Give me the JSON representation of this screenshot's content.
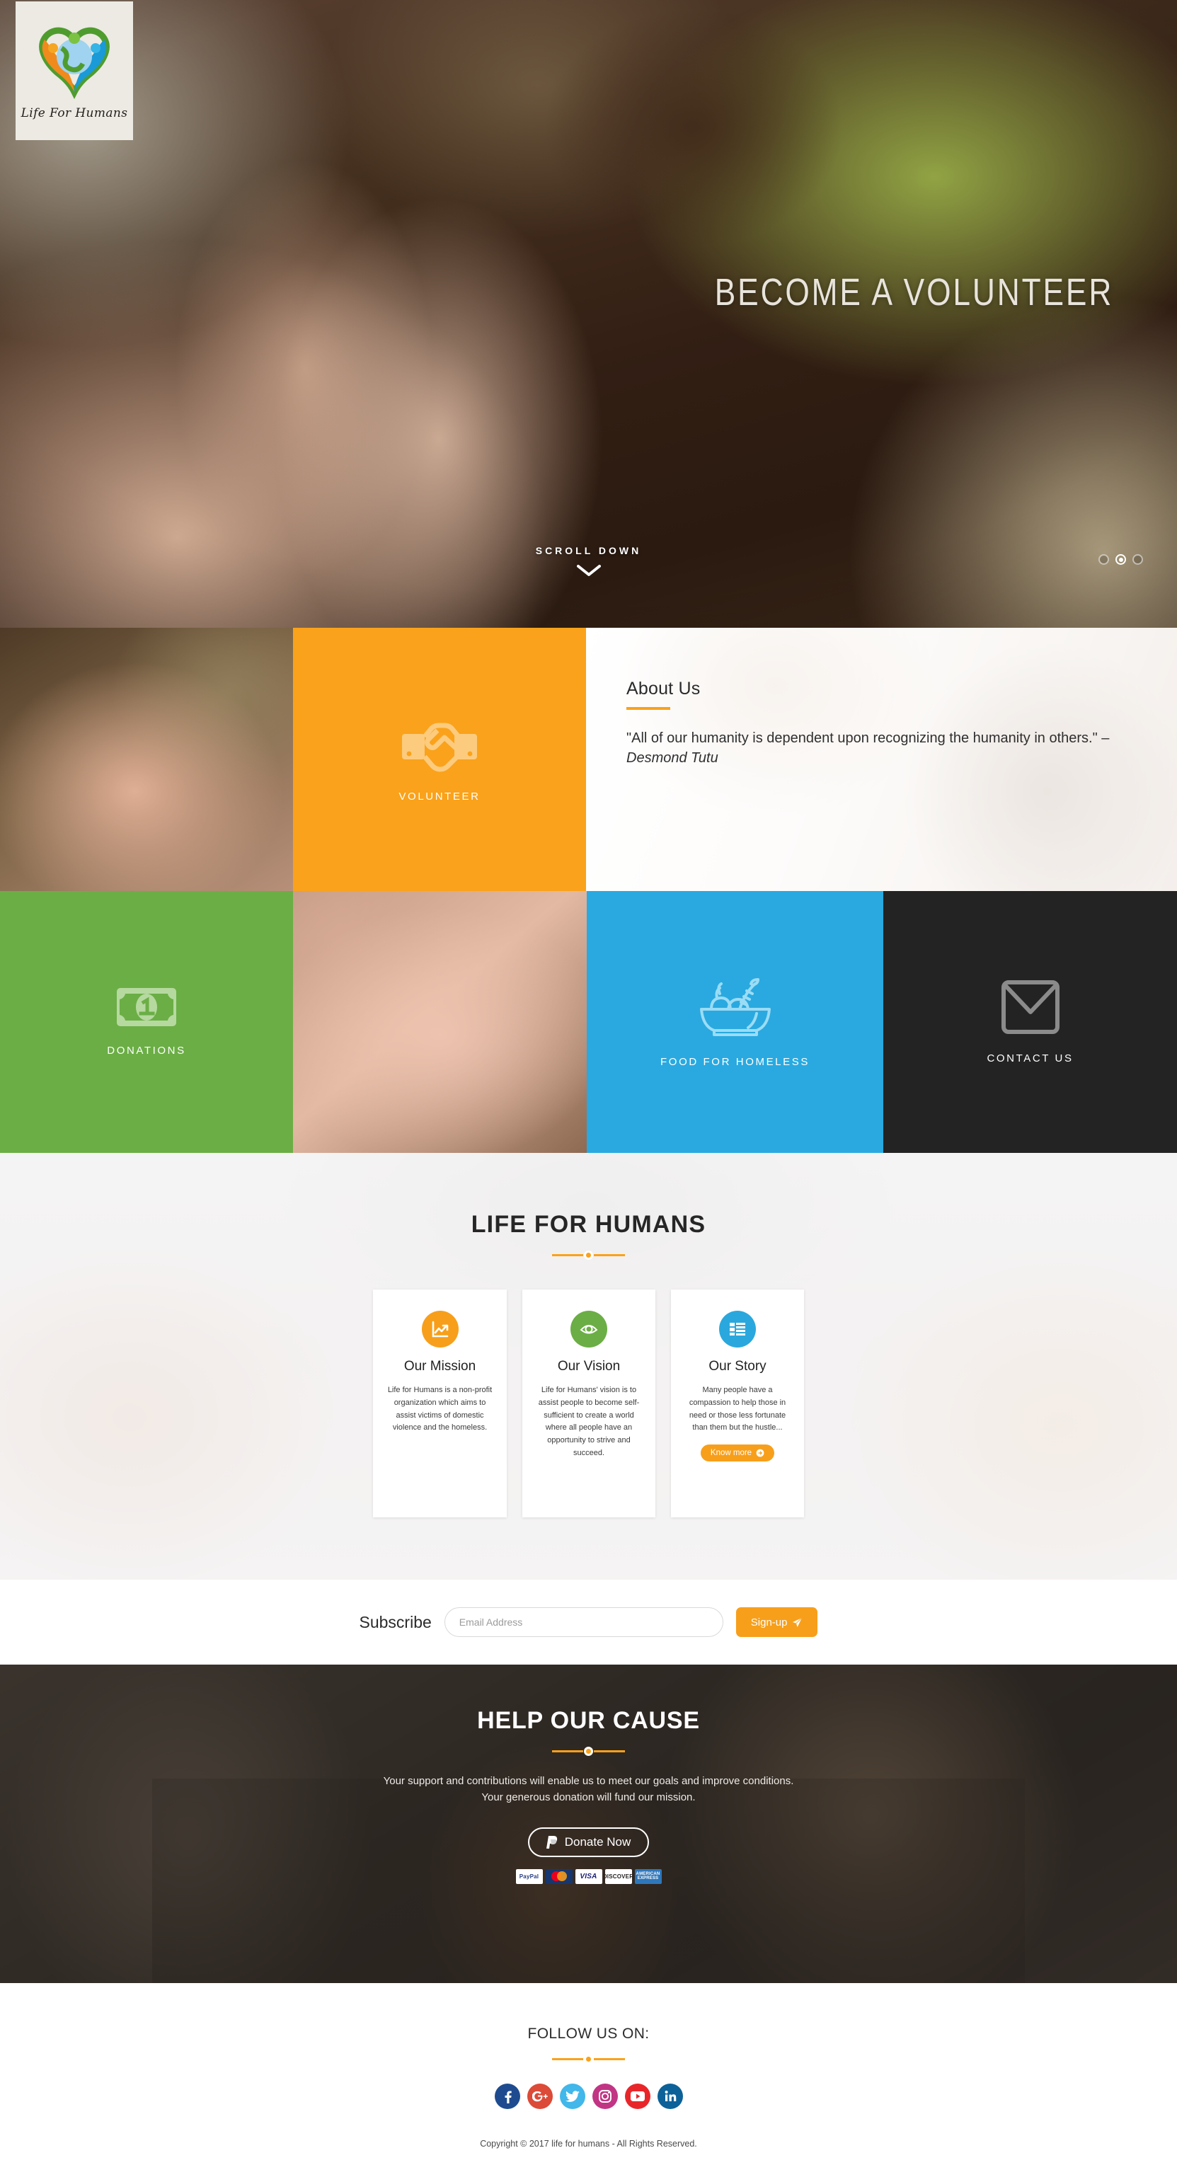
{
  "brand": {
    "logo_icon": "heart-globe-logo-icon",
    "logo_text": "Life For Humans"
  },
  "hero": {
    "title": "BECOME A VOLUNTEER",
    "scroll_label": "SCROLL DOWN",
    "scroll_icon": "chevron-down-icon",
    "carousel": {
      "total": 3,
      "active_index": 2
    }
  },
  "tiles": {
    "volunteer": {
      "label": "VOLUNTEER",
      "icon": "handshake-icon",
      "color": "#FAA21B"
    },
    "donations": {
      "label": "DONATIONS",
      "icon": "banknote-icon",
      "color": "#6BAE45"
    },
    "food": {
      "label": "FOOD FOR HOMELESS",
      "icon": "food-bowl-icon",
      "color": "#29A9E0"
    },
    "contact": {
      "label": "CONTACT US",
      "icon": "envelope-icon",
      "color": "#232323"
    }
  },
  "about": {
    "title": "About Us",
    "quote_prefix": "\"All of our humanity is dependent upon recognizing the humanity in others.\" – ",
    "quote_author": "Desmond Tutu"
  },
  "life_for_humans": {
    "heading": "LIFE FOR HUMANS",
    "cards": [
      {
        "title": "Our Mission",
        "icon": "chart-line-icon",
        "icon_color": "#F79F1B",
        "text": "Life for Humans is a non-profit organization which aims to assist victims of domestic violence and the homeless."
      },
      {
        "title": "Our Vision",
        "icon": "eye-icon",
        "icon_color": "#6BAE45",
        "text": "Life for Humans' vision is to assist people to become self-sufficient to create a world where all people have an opportunity to strive and succeed."
      },
      {
        "title": "Our Story",
        "icon": "list-icon",
        "icon_color": "#2AA8DD",
        "text": "Many people have a compassion to help those in need or those less fortunate than them but the hustle...",
        "button_label": "Know more",
        "button_icon": "arrow-circle-right-icon"
      }
    ]
  },
  "subscribe": {
    "label": "Subscribe",
    "placeholder": "Email Address",
    "value": "",
    "button_label": "Sign-up",
    "button_icon": "paper-plane-icon"
  },
  "cause": {
    "title": "HELP OUR CAUSE",
    "text": "Your support and contributions will enable us to meet our goals and improve conditions. Your generous donation will fund our mission.",
    "donate_label": "Donate Now",
    "donate_icon": "paypal-icon",
    "payments": [
      {
        "name": "paypal-logo-icon",
        "text": "PayPal"
      },
      {
        "name": "mastercard-logo-icon",
        "text": "MasterCard"
      },
      {
        "name": "visa-logo-icon",
        "text": "VISA"
      },
      {
        "name": "discover-logo-icon",
        "text": "DISCOVER"
      },
      {
        "name": "amex-logo-icon",
        "text": "AMERICAN EXPRESS"
      }
    ]
  },
  "footer": {
    "follow_title": "FOLLOW US ON:",
    "socials": [
      {
        "name": "facebook-icon",
        "glyph": "f"
      },
      {
        "name": "google-plus-icon",
        "glyph": "G+"
      },
      {
        "name": "twitter-icon",
        "glyph": "t"
      },
      {
        "name": "instagram-icon",
        "glyph": "ig"
      },
      {
        "name": "youtube-icon",
        "glyph": "You Tube"
      },
      {
        "name": "linkedin-icon",
        "glyph": "in"
      }
    ],
    "copyright": "Copyright © 2017 life for humans - All Rights Reserved."
  },
  "colors": {
    "orange": "#FAA21B",
    "green": "#6BAE45",
    "blue": "#29A9E0",
    "dark": "#232323"
  }
}
